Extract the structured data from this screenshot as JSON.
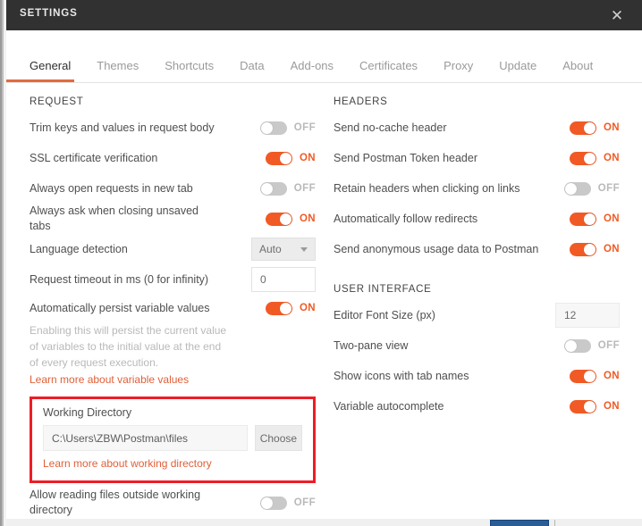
{
  "window": {
    "title": "SETTINGS",
    "close_icon": "close-icon",
    "close_glyph": "✕"
  },
  "colors": {
    "accent": "#f15a24",
    "tab_underline": "#e26b3e",
    "link": "#e0603a",
    "highlight_box": "#ee1c25",
    "titlebar_bg": "#313131",
    "toggle_off": "#c9c9c9"
  },
  "tabs": [
    {
      "label": "General",
      "active": true
    },
    {
      "label": "Themes",
      "active": false
    },
    {
      "label": "Shortcuts",
      "active": false
    },
    {
      "label": "Data",
      "active": false
    },
    {
      "label": "Add-ons",
      "active": false
    },
    {
      "label": "Certificates",
      "active": false
    },
    {
      "label": "Proxy",
      "active": false
    },
    {
      "label": "Update",
      "active": false
    },
    {
      "label": "About",
      "active": false
    }
  ],
  "left": {
    "section_title": "REQUEST",
    "rows": [
      {
        "label": "Trim keys and values in request body",
        "state": "OFF"
      },
      {
        "label": "SSL certificate verification",
        "state": "ON"
      },
      {
        "label": "Always open requests in new tab",
        "state": "OFF"
      },
      {
        "label": "Always ask when closing unsaved tabs",
        "state": "ON"
      }
    ],
    "language_detection": {
      "label": "Language detection",
      "value": "Auto"
    },
    "request_timeout": {
      "label": "Request timeout in ms (0 for infinity)",
      "value": "0",
      "placeholder": "0"
    },
    "persist_variables": {
      "label": "Automatically persist variable values",
      "state": "ON",
      "help": "Enabling this will persist the current value of variables to the initial value at the end of every request execution.",
      "link": "Learn more about variable values"
    },
    "working_directory": {
      "title": "Working Directory",
      "value": "C:\\Users\\ZBW\\Postman\\files",
      "placeholder": "C:\\Users\\ZBW\\Postman\\files",
      "choose_label": "Choose",
      "link": "Learn more about working directory"
    },
    "allow_outside": {
      "label": "Allow reading files outside working directory",
      "state": "OFF"
    }
  },
  "right": {
    "headers_section_title": "HEADERS",
    "headers_rows": [
      {
        "label": "Send no-cache header",
        "state": "ON"
      },
      {
        "label": "Send Postman Token header",
        "state": "ON"
      },
      {
        "label": "Retain headers when clicking on links",
        "state": "OFF"
      },
      {
        "label": "Automatically follow redirects",
        "state": "ON"
      },
      {
        "label": "Send anonymous usage data to Postman",
        "state": "ON"
      }
    ],
    "ui_section_title": "USER INTERFACE",
    "editor_font_size": {
      "label": "Editor Font Size (px)",
      "value": "12",
      "placeholder": "12"
    },
    "ui_rows": [
      {
        "label": "Two-pane view",
        "state": "OFF"
      },
      {
        "label": "Show icons with tab names",
        "state": "ON"
      },
      {
        "label": "Variable autocomplete",
        "state": "ON"
      }
    ]
  }
}
